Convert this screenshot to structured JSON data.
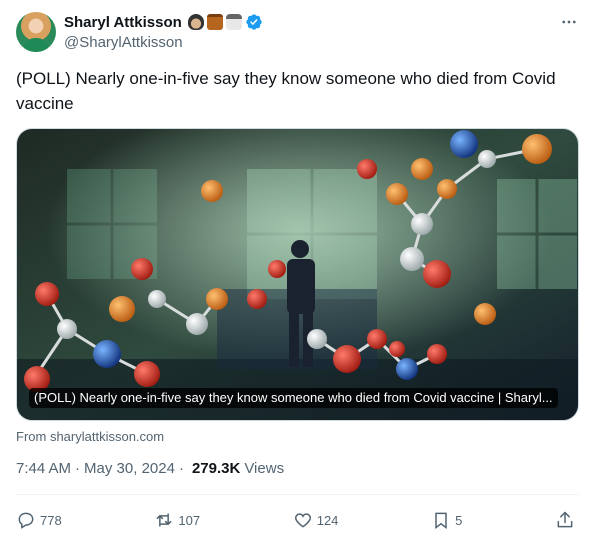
{
  "author": {
    "display_name": "Sharyl Attkisson",
    "handle": "@SharylAttkisson",
    "emojis": [
      "spy-emoji",
      "briefcase-emoji",
      "martial-arts-uniform-emoji"
    ],
    "verified": true,
    "verified_color": "#1d9bf0"
  },
  "tweet": {
    "text": "(POLL) Nearly one-in-five say they know someone who died from Covid vaccine"
  },
  "card": {
    "caption": "(POLL) Nearly one-in-five say they know someone who died from Covid vaccine | Sharyl...",
    "source": "From sharylattkisson.com",
    "image": "illustration-man-in-lab-with-molecule-models"
  },
  "meta": {
    "time": "7:44 AM",
    "separator": "·",
    "date": "May 30, 2024",
    "views_count": "279.3K",
    "views_label": "Views"
  },
  "actions": {
    "replies": "778",
    "reposts": "107",
    "likes": "124",
    "bookmarks": "5"
  },
  "colors": {
    "text_primary": "#0f1419",
    "text_secondary": "#536471",
    "border": "#cfd9de"
  }
}
